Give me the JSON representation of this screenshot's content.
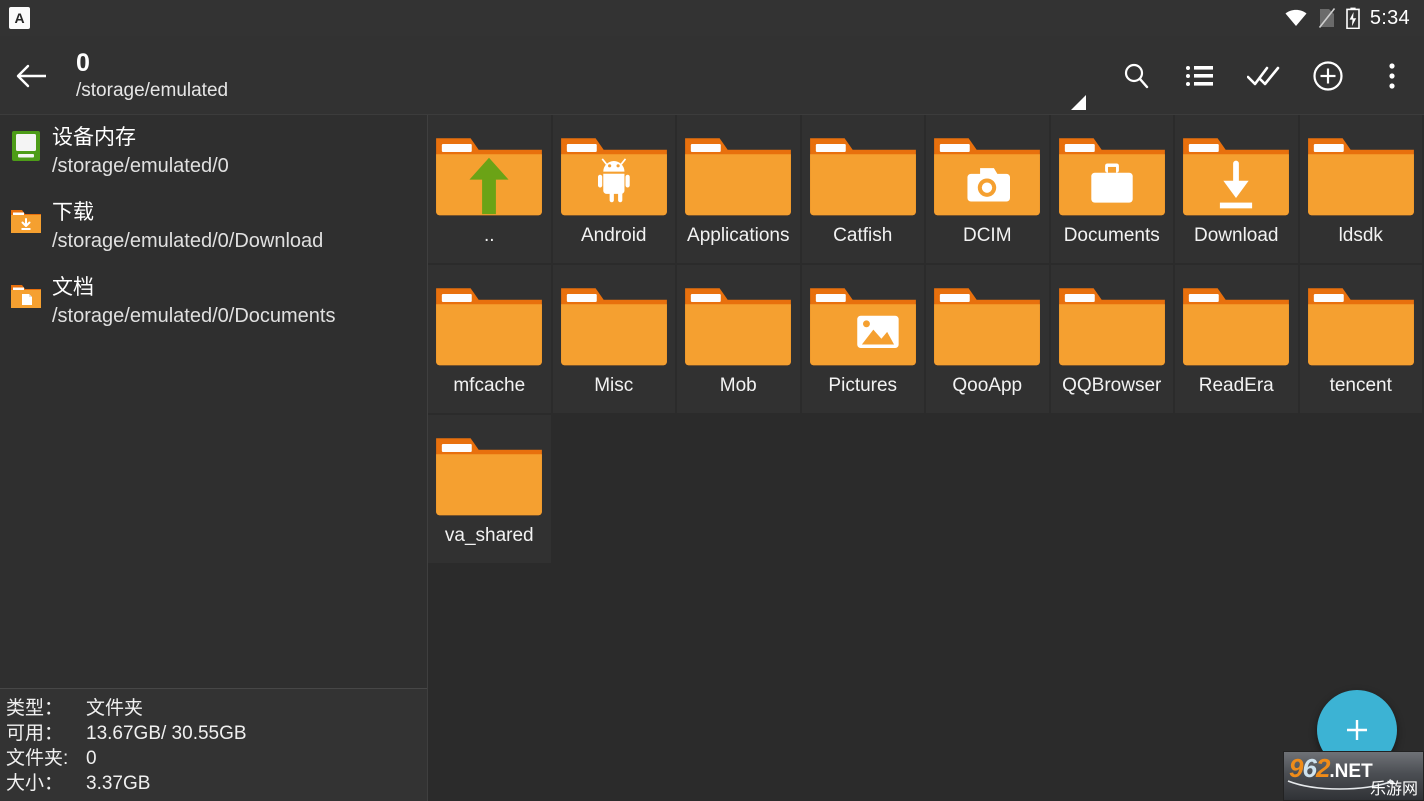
{
  "statusbar": {
    "app_icon": "notification-app-icon",
    "app_icon_letter": "A",
    "icons": [
      "wifi-icon",
      "sim-off-icon",
      "battery-charging-icon"
    ],
    "clock": "5:34"
  },
  "toolbar": {
    "back_icon": "back-arrow-icon",
    "title": "0",
    "subtitle": "/storage/emulated",
    "actions": [
      {
        "name": "search-icon",
        "label": "Search"
      },
      {
        "name": "list-view-icon",
        "label": "List view"
      },
      {
        "name": "select-all-icon",
        "label": "Select all"
      },
      {
        "name": "add-circle-icon",
        "label": "Add"
      },
      {
        "name": "overflow-menu-icon",
        "label": "More options"
      }
    ]
  },
  "sidebar": {
    "items": [
      {
        "icon": "device-storage-icon",
        "name": "设备内存",
        "path": "/storage/emulated/0"
      },
      {
        "icon": "download-folder-icon",
        "name": "下载",
        "path": "/storage/emulated/0/Download"
      },
      {
        "icon": "documents-folder-icon",
        "name": "文档",
        "path": "/storage/emulated/0/Documents"
      }
    ]
  },
  "info_panel": {
    "rows": [
      {
        "key": "类型：",
        "value": "文件夹"
      },
      {
        "key": "可用：",
        "value": "13.67GB/ 30.55GB"
      },
      {
        "key": "文件夹:",
        "value": "0"
      },
      {
        "key": "大小：",
        "value": "3.37GB"
      }
    ]
  },
  "grid": {
    "rows": [
      [
        {
          "label": "..",
          "icon": "folder-up-icon"
        },
        {
          "label": "Android",
          "icon": "folder-android-icon"
        },
        {
          "label": "Applications",
          "icon": "folder-plain-icon"
        },
        {
          "label": "Catfish",
          "icon": "folder-plain-icon"
        },
        {
          "label": "DCIM",
          "icon": "folder-camera-icon"
        },
        {
          "label": "Documents",
          "icon": "folder-briefcase-icon"
        },
        {
          "label": "Download",
          "icon": "folder-download-icon"
        },
        {
          "label": "ldsdk",
          "icon": "folder-plain-icon"
        }
      ],
      [
        {
          "label": "mfcache",
          "icon": "folder-plain-icon"
        },
        {
          "label": "Misc",
          "icon": "folder-plain-icon"
        },
        {
          "label": "Mob",
          "icon": "folder-plain-icon"
        },
        {
          "label": "Pictures",
          "icon": "folder-image-icon"
        },
        {
          "label": "QooApp",
          "icon": "folder-plain-icon"
        },
        {
          "label": "QQBrowser",
          "icon": "folder-plain-icon"
        },
        {
          "label": "ReadEra",
          "icon": "folder-plain-icon"
        },
        {
          "label": "tencent",
          "icon": "folder-plain-icon"
        }
      ],
      [
        {
          "label": "va_shared",
          "icon": "folder-plain-icon"
        }
      ]
    ]
  },
  "fab": {
    "icon": "plus-icon",
    "label": "Create"
  },
  "watermark": {
    "digit1": "9",
    "digit2": "6",
    "digit3": "2",
    "tld": ".NET",
    "cn": "乐游网"
  },
  "colors": {
    "folder_body": "#f5a030",
    "folder_tab": "#e8700d",
    "accent_fab": "#3cb3d4",
    "storage_green": "#4d9c18",
    "window_bg": "#2b2b2b",
    "panel_bg": "#333333",
    "cell_bg": "#313131"
  }
}
